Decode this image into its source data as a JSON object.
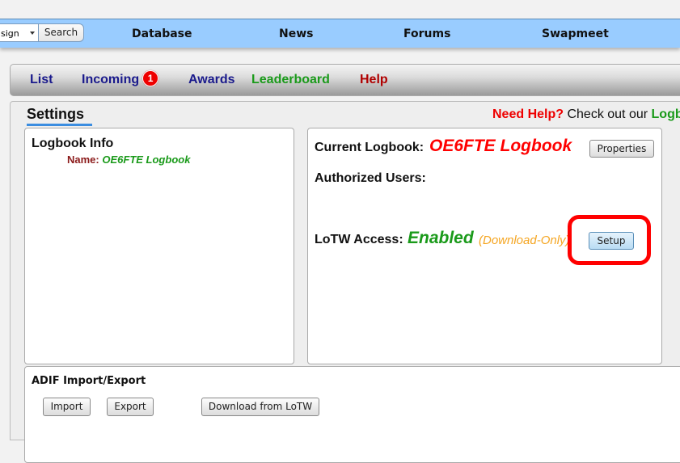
{
  "topbar": {
    "search_select_value": "sign",
    "search_button": "Search",
    "nav": [
      "Database",
      "News",
      "Forums",
      "Swapmeet"
    ]
  },
  "tabs": [
    {
      "label": "List",
      "color": "#1a1a8c"
    },
    {
      "label": "Incoming",
      "color": "#1a1a8c",
      "badge": "1"
    },
    {
      "label": "Awards",
      "color": "#1a1a8c"
    },
    {
      "label": "Leaderboard",
      "color": "#1a9a1a"
    },
    {
      "label": "Help",
      "color": "#b00000"
    }
  ],
  "settings": {
    "title": "Settings",
    "help_prefix": "Need Help?",
    "help_text": " Check out our ",
    "help_link": "Logb"
  },
  "logbook_info": {
    "title": "Logbook Info",
    "name_label": "Name:",
    "name_value": "OE6FTE Logbook"
  },
  "current": {
    "label": "Current Logbook:",
    "value": "OE6FTE Logbook",
    "properties_button": "Properties",
    "authorized_label": "Authorized Users:",
    "lotw_label": "LoTW Access:",
    "lotw_status": "Enabled",
    "lotw_note": "(Download-Only)",
    "setup_button": "Setup"
  },
  "adif": {
    "title": "ADIF Import/Export",
    "import_button": "Import",
    "export_button": "Export",
    "download_button": "Download from LoTW"
  }
}
